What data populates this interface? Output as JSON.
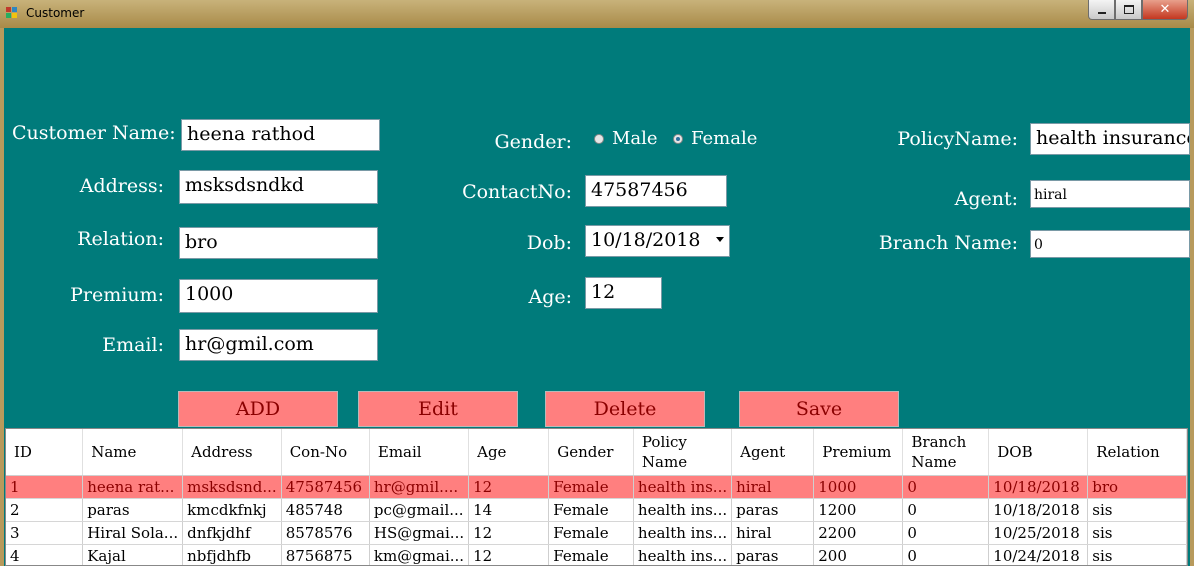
{
  "window": {
    "title": "Customer",
    "min": "0",
    "max": "1",
    "close": "r"
  },
  "colors": {
    "form_bg": "#007b7b",
    "button_bg": "#ff7f7f",
    "button_text": "#8b0000",
    "selected_row": "#ff7f7f"
  },
  "labels": {
    "customer_name": "Customer Name:",
    "address": "Address:",
    "relation": "Relation:",
    "premium": "Premium:",
    "email": "Email:",
    "gender": "Gender:",
    "contact": "ContactNo:",
    "dob": "Dob:",
    "age": "Age:",
    "policy": "PolicyName:",
    "agent": "Agent:",
    "branch": "Branch Name:"
  },
  "fields": {
    "customer_name": "heena rathod",
    "address": "msksdsndkd",
    "relation": "bro",
    "premium": "1000",
    "email": "hr@gmil.com",
    "contact": "47587456",
    "dob": "10/18/2018",
    "age": "12",
    "policy": "health insurance",
    "agent": "hiral",
    "branch": "0"
  },
  "gender": {
    "male": "Male",
    "female": "Female",
    "selected": "Female"
  },
  "buttons": {
    "add": "ADD",
    "edit": "Edit",
    "delete": "Delete",
    "save": "Save"
  },
  "grid": {
    "headers": [
      "ID",
      "Name",
      "Address",
      "Con-No",
      "Email",
      "Age",
      "Gender",
      "Policy Name",
      "Agent",
      "Premium",
      "Branch Name",
      "DOB",
      "Relation"
    ],
    "rows": [
      [
        "1",
        "heena rat...",
        "msksdsnd...",
        "47587456",
        "hr@gmil....",
        "12",
        "Female",
        "health ins...",
        "hiral",
        "1000",
        "0",
        "10/18/2018",
        "bro"
      ],
      [
        "2",
        "paras",
        "kmcdkfnkj",
        "485748",
        "pc@gmail...",
        "14",
        "Female",
        "health ins...",
        "paras",
        "1200",
        "0",
        "10/18/2018",
        "sis"
      ],
      [
        "3",
        "Hiral Sola...",
        "dnfkjdhf",
        "8578576",
        "HS@gmai...",
        "12",
        "Female",
        "health ins...",
        "hiral",
        "2200",
        "0",
        "10/25/2018",
        "sis"
      ],
      [
        "4",
        "Kajal",
        "nbfjdhfb",
        "8756875",
        "km@gmai...",
        "12",
        "Female",
        "health ins...",
        "paras",
        "200",
        "0",
        "10/24/2018",
        "sis"
      ]
    ]
  }
}
